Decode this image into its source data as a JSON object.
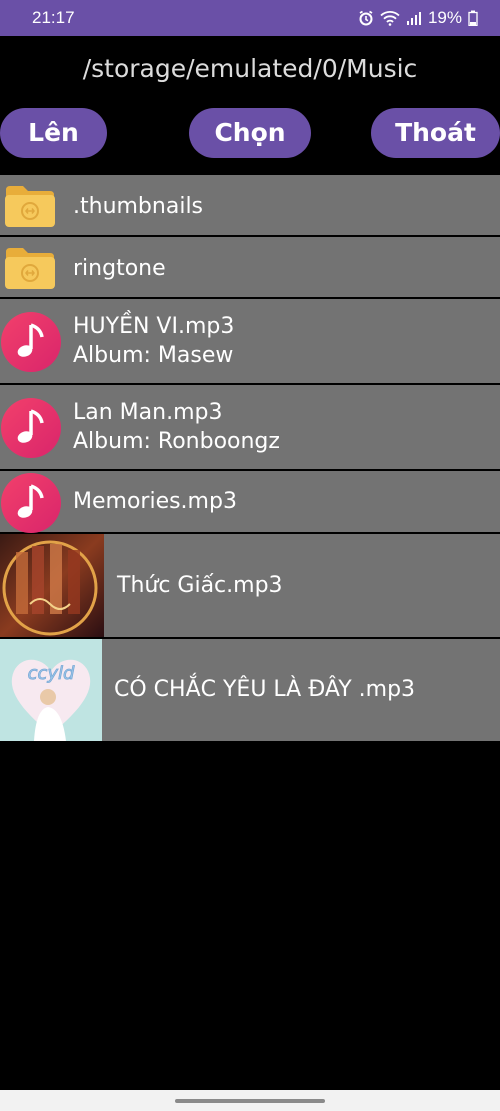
{
  "status_bar": {
    "time": "21:17",
    "battery": "19%"
  },
  "path": "/storage/emulated/0/Music",
  "buttons": {
    "up": "Lên",
    "select": "Chọn",
    "exit": "Thoát"
  },
  "files": [
    {
      "name": ".thumbnails",
      "type": "folder"
    },
    {
      "name": "ringtone",
      "type": "folder"
    },
    {
      "name": "HUYỀN VI.mp3",
      "album": "Album: Masew",
      "type": "music"
    },
    {
      "name": "Lan Man.mp3",
      "album": "Album: Ronboongz",
      "type": "music"
    },
    {
      "name": "Memories.mp3",
      "type": "music"
    },
    {
      "name": "Thức Giấc.mp3",
      "type": "artwork"
    },
    {
      "name": "CÓ CHẮC YÊU LÀ ĐÂY .mp3",
      "type": "artwork"
    }
  ],
  "colors": {
    "accent": "#6a50a7",
    "row_bg": "#737373",
    "folder": "#f6c95c",
    "music_icon": "#e8336a"
  }
}
